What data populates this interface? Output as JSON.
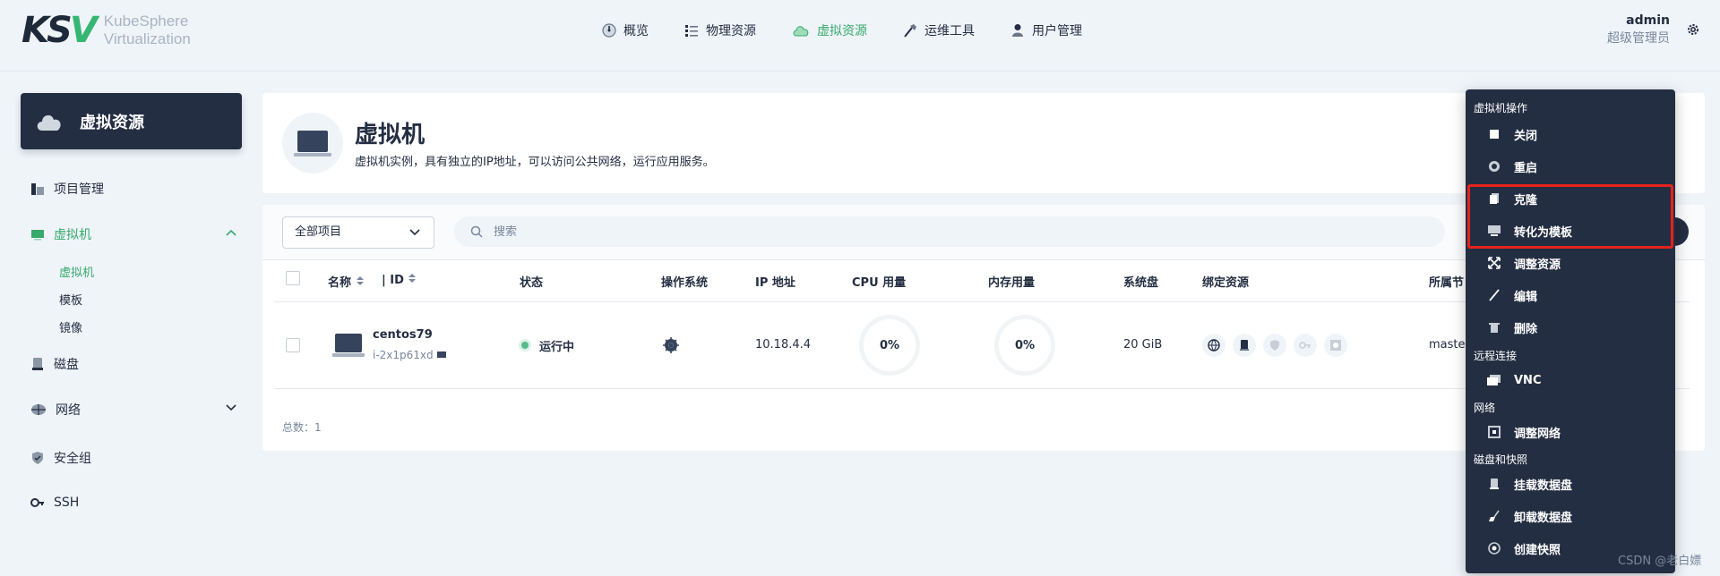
{
  "brand": {
    "mark_k": "KS",
    "mark_v": "V",
    "line1": "KubeSphere",
    "line2": "Virtualization"
  },
  "nav": [
    {
      "label": "概览",
      "icon": "dashboard-icon"
    },
    {
      "label": "物理资源",
      "icon": "list-icon"
    },
    {
      "label": "虚拟资源",
      "icon": "cloud-icon",
      "active": true
    },
    {
      "label": "运维工具",
      "icon": "hammer-icon"
    },
    {
      "label": "用户管理",
      "icon": "user-icon"
    }
  ],
  "user": {
    "name": "admin",
    "role": "超级管理员"
  },
  "sidebar": {
    "header": "虚拟资源",
    "items": [
      {
        "label": "项目管理"
      },
      {
        "label": "虚拟机"
      },
      {
        "label": "磁盘"
      },
      {
        "label": "网络"
      },
      {
        "label": "安全组"
      },
      {
        "label": "SSH"
      }
    ],
    "sub_items": [
      {
        "label": "虚拟机"
      },
      {
        "label": "模板"
      },
      {
        "label": "镜像"
      }
    ]
  },
  "page": {
    "title": "虚拟机",
    "description": "虚拟机实例，具有独立的IP地址，可以访问公共网络，运行应用服务。"
  },
  "toolbar": {
    "project_select": "全部项目",
    "search_placeholder": "搜索"
  },
  "table": {
    "columns": {
      "name": "名称",
      "id": "| ID",
      "status": "状态",
      "os": "操作系统",
      "ip": "IP 地址",
      "cpu": "CPU 用量",
      "memory": "内存用量",
      "disk": "系统盘",
      "resources": "绑定资源",
      "node": "所属节"
    },
    "rows": [
      {
        "name": "centos79",
        "id": "i-2x1p61xd",
        "status": "运行中",
        "ip": "10.18.4.4",
        "cpu": "0%",
        "memory": "0%",
        "disk": "20 GiB",
        "node": "master"
      }
    ],
    "total": "总数：1"
  },
  "menu": {
    "groups": {
      "vm_ops": "虚拟机操作",
      "remote": "远程连接",
      "network": "网络",
      "disk": "磁盘和快照"
    },
    "items": {
      "close": "关闭",
      "restart": "重启",
      "clone": "克隆",
      "to_template": "转化为模板",
      "resize": "调整资源",
      "edit": "编辑",
      "delete": "删除",
      "vnc": "VNC",
      "adjust_network": "调整网络",
      "mount_disk": "挂载数据盘",
      "unmount_disk": "卸载数据盘",
      "snapshot": "创建快照"
    }
  },
  "watermark": "CSDN @老白嫖",
  "colors": {
    "accent": "#36a96b",
    "dark": "#242e42",
    "highlight": "#e5221b",
    "background": "#eff4f9"
  }
}
